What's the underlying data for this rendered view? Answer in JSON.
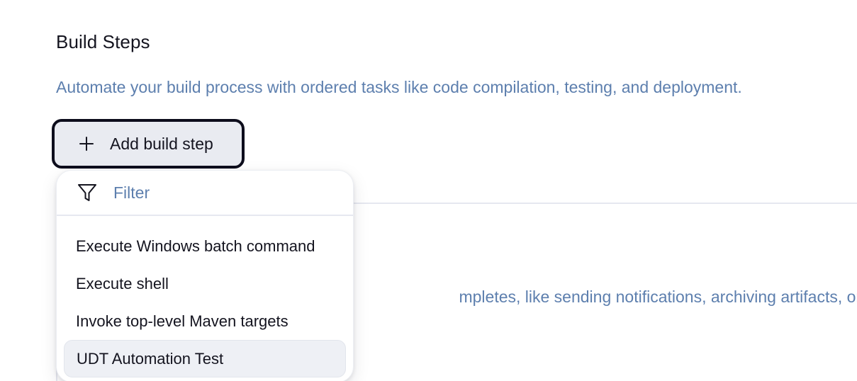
{
  "build_steps": {
    "title": "Build Steps",
    "description": "Automate your build process with ordered tasks like code compilation, testing, and deployment.",
    "add_button_label": "Add build step",
    "add_button_icon": "plus-icon"
  },
  "dropdown": {
    "filter_icon": "funnel-icon",
    "filter_placeholder": "Filter",
    "items": [
      {
        "label": "Execute Windows batch command",
        "hovered": false
      },
      {
        "label": "Execute shell",
        "hovered": false
      },
      {
        "label": "Invoke top-level Maven targets",
        "hovered": false
      },
      {
        "label": "UDT Automation Test",
        "hovered": true
      }
    ]
  },
  "post_build": {
    "description_visible_fragment": "mpletes, like sending notifications, archiving artifacts, or trigge"
  },
  "colors": {
    "text_primary": "#14141f",
    "text_secondary": "#5d7fae",
    "button_bg": "#e9ebf1",
    "button_border": "#0d0d1c",
    "hover_bg": "#eef0f5",
    "divider": "#e6e8f0"
  }
}
